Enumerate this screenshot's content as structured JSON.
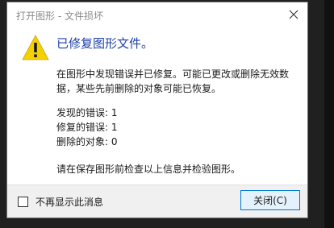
{
  "window": {
    "title": "打开图形 - 文件损坏"
  },
  "message": {
    "headline": "已修复图形文件。",
    "description": "在图形中发现错误并已修复。可能已更改或删除无效数据，某些先前删除的对象可能已恢复。",
    "errors_found": "发现的错误:  1",
    "errors_fixed": "修复的错误:  1",
    "objects_deleted": "删除的对象:  0",
    "advice": "请在保存图形前检查以上信息并检验图形。"
  },
  "footer": {
    "checkbox_label": "不再显示此消息",
    "checkbox_checked": false,
    "close_label": "关闭(C)"
  },
  "icons": {
    "warning": "warning-icon",
    "close": "close-icon"
  },
  "colors": {
    "headline": "#1c3fa8",
    "warning_fill": "#f5d000",
    "button_border": "#0078d7"
  }
}
